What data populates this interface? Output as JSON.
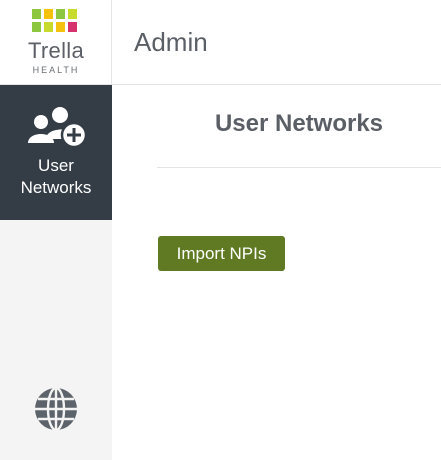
{
  "logo": {
    "name": "Trella",
    "subtitle": "HEALTH",
    "colors": [
      "#8dc63f",
      "#f4c20d",
      "#8dc63f",
      "#c8da2b",
      "#8dc63f",
      "#c8da2b",
      "#f4c20d",
      "#d6336c"
    ]
  },
  "header": {
    "title": "Admin"
  },
  "sidebar": {
    "items": [
      {
        "label_line1": "User",
        "label_line2": "Networks",
        "icon": "user-add-icon",
        "active": true
      }
    ],
    "footer_icon": "globe-icon"
  },
  "main": {
    "title": "User Networks",
    "import_button_label": "Import NPIs"
  },
  "colors": {
    "sidebar_active_bg": "#343d46",
    "sidebar_bg": "#f4f4f4",
    "button_bg": "#5f7a22",
    "text": "#5a5f66"
  }
}
